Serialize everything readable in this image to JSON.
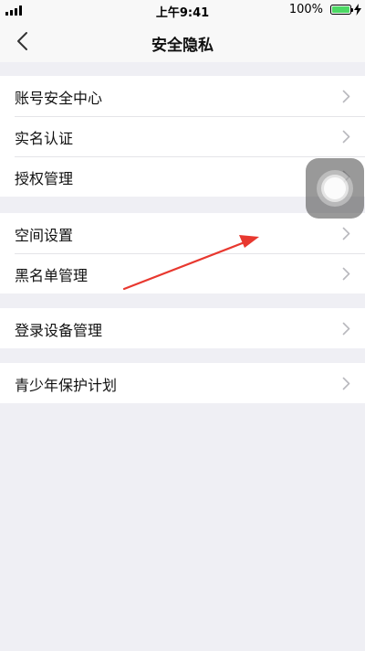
{
  "status_bar": {
    "time": "上午9:41",
    "battery_percent": "100%",
    "battery_color": "#4cd964"
  },
  "nav": {
    "title": "安全隐私",
    "back_icon": "chevron-left-icon"
  },
  "groups": [
    {
      "items": [
        {
          "label": "账号安全中心"
        },
        {
          "label": "实名认证"
        },
        {
          "label": "授权管理"
        }
      ]
    },
    {
      "items": [
        {
          "label": "空间设置"
        },
        {
          "label": "黑名单管理"
        }
      ]
    },
    {
      "items": [
        {
          "label": "登录设备管理"
        }
      ]
    },
    {
      "items": [
        {
          "label": "青少年保护计划"
        }
      ]
    }
  ],
  "overlay": {
    "assistive_touch_icon": "assistive-touch-icon",
    "annotation_arrow_color": "#e8382f"
  }
}
